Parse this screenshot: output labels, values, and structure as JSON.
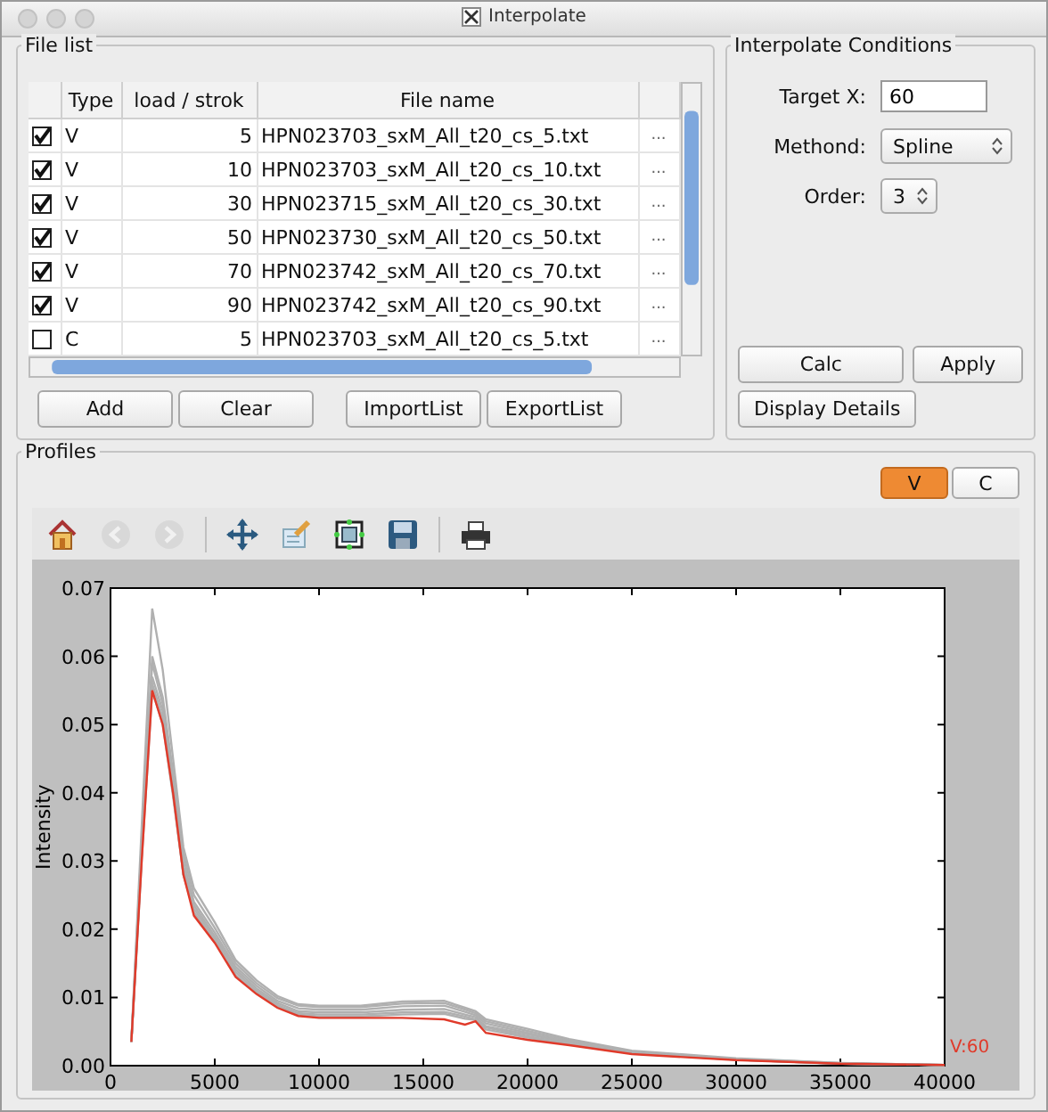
{
  "window": {
    "title": "Interpolate"
  },
  "file_list": {
    "title": "File list",
    "columns": [
      "Type",
      "load / strok",
      "File name"
    ],
    "rows": [
      {
        "checked": true,
        "type": "V",
        "load": "5",
        "file": "HPN023703_sxM_All_t20_cs_5.txt",
        "more": "..."
      },
      {
        "checked": true,
        "type": "V",
        "load": "10",
        "file": "HPN023703_sxM_All_t20_cs_10.txt",
        "more": "..."
      },
      {
        "checked": true,
        "type": "V",
        "load": "30",
        "file": "HPN023715_sxM_All_t20_cs_30.txt",
        "more": "..."
      },
      {
        "checked": true,
        "type": "V",
        "load": "50",
        "file": "HPN023730_sxM_All_t20_cs_50.txt",
        "more": "..."
      },
      {
        "checked": true,
        "type": "V",
        "load": "70",
        "file": "HPN023742_sxM_All_t20_cs_70.txt",
        "more": "..."
      },
      {
        "checked": true,
        "type": "V",
        "load": "90",
        "file": "HPN023742_sxM_All_t20_cs_90.txt",
        "more": "..."
      },
      {
        "checked": false,
        "type": "C",
        "load": "5",
        "file": "HPN023703_sxM_All_t20_cs_5.txt",
        "more": "..."
      }
    ],
    "buttons": [
      "Add",
      "Clear",
      "ImportList",
      "ExportList"
    ]
  },
  "conditions": {
    "title": "Interpolate Conditions",
    "target_label": "Target X:",
    "target_value": "60",
    "method_label": "Methond:",
    "method_value": "Spline",
    "order_label": "Order:",
    "order_value": "3",
    "buttons": [
      "Calc",
      "Apply",
      "Display Details"
    ]
  },
  "profiles": {
    "title": "Profiles",
    "toggles": [
      {
        "label": "V",
        "selected": true
      },
      {
        "label": "C",
        "selected": false
      }
    ],
    "toolbar": [
      {
        "kind": "home",
        "disabled": false
      },
      {
        "kind": "back",
        "disabled": true
      },
      {
        "kind": "forward",
        "disabled": true
      },
      {
        "kind": "sep"
      },
      {
        "kind": "pan",
        "disabled": false
      },
      {
        "kind": "edit",
        "disabled": false
      },
      {
        "kind": "subplots",
        "disabled": false
      },
      {
        "kind": "save",
        "disabled": false
      },
      {
        "kind": "sep"
      },
      {
        "kind": "print",
        "disabled": false
      }
    ],
    "chart_data": {
      "type": "line",
      "ylabel": "Intensity",
      "x": [
        1000,
        1500,
        2000,
        2500,
        3000,
        3500,
        4000,
        5000,
        6000,
        7000,
        8000,
        9000,
        10000,
        12000,
        14000,
        16000,
        17000,
        17500,
        18000,
        20000,
        22000,
        25000,
        30000,
        35000,
        40000
      ],
      "series": [
        {
          "color": "#b0b0b0",
          "values": [
            0.0035,
            0.035,
            0.067,
            0.058,
            0.045,
            0.032,
            0.026,
            0.021,
            0.0155,
            0.0125,
            0.0102,
            0.009,
            0.0088,
            0.0088,
            0.0094,
            0.0095,
            0.0085,
            0.008,
            0.0068,
            0.0054,
            0.0039,
            0.0022,
            0.0011,
            0.0004,
            0.0001
          ]
        },
        {
          "color": "#b0b0b0",
          "values": [
            0.0035,
            0.033,
            0.06,
            0.054,
            0.043,
            0.031,
            0.025,
            0.0202,
            0.015,
            0.0121,
            0.0099,
            0.0088,
            0.0086,
            0.0086,
            0.0091,
            0.0092,
            0.0082,
            0.0077,
            0.0065,
            0.0051,
            0.0037,
            0.002,
            0.001,
            0.0004,
            0.0001
          ]
        },
        {
          "color": "#b0b0b0",
          "values": [
            0.0035,
            0.032,
            0.059,
            0.053,
            0.042,
            0.03,
            0.024,
            0.0195,
            0.0145,
            0.0117,
            0.0095,
            0.0084,
            0.0082,
            0.0082,
            0.0087,
            0.0088,
            0.0079,
            0.0074,
            0.0062,
            0.0048,
            0.0035,
            0.0019,
            0.001,
            0.0003,
            0.0001
          ]
        },
        {
          "color": "#b0b0b0",
          "values": [
            0.0035,
            0.031,
            0.057,
            0.052,
            0.041,
            0.029,
            0.0235,
            0.019,
            0.0141,
            0.0113,
            0.0092,
            0.008,
            0.0078,
            0.0078,
            0.0082,
            0.0083,
            0.0075,
            0.0071,
            0.0058,
            0.0046,
            0.0034,
            0.0019,
            0.0009,
            0.0003,
            0.0001
          ]
        },
        {
          "color": "#b0b0b0",
          "values": [
            0.0035,
            0.031,
            0.056,
            0.051,
            0.04,
            0.028,
            0.023,
            0.0186,
            0.0137,
            0.011,
            0.0089,
            0.0077,
            0.0075,
            0.0075,
            0.0078,
            0.0079,
            0.0072,
            0.0068,
            0.0056,
            0.0043,
            0.0032,
            0.0018,
            0.0009,
            0.0003,
            0.0001
          ]
        },
        {
          "color": "#b0b0b0",
          "values": [
            0.0035,
            0.03,
            0.055,
            0.05,
            0.0395,
            0.028,
            0.0225,
            0.0182,
            0.0133,
            0.0107,
            0.0087,
            0.0075,
            0.0072,
            0.0072,
            0.0075,
            0.0076,
            0.0069,
            0.0067,
            0.0053,
            0.0041,
            0.0031,
            0.0018,
            0.0009,
            0.0003,
            0.0001
          ]
        },
        {
          "color": "#e03a2a",
          "values": [
            0.0035,
            0.03,
            0.055,
            0.05,
            0.04,
            0.028,
            0.022,
            0.018,
            0.013,
            0.0105,
            0.0085,
            0.0073,
            0.007,
            0.007,
            0.007,
            0.0068,
            0.006,
            0.0065,
            0.0048,
            0.0038,
            0.003,
            0.0017,
            0.0008,
            0.0003,
            0.0001
          ]
        }
      ],
      "xlim": [
        0,
        40000
      ],
      "ylim": [
        0,
        0.07
      ],
      "xticks": [
        {
          "value": 0,
          "label": "0"
        },
        {
          "value": 5000,
          "label": "5000"
        },
        {
          "value": 10000,
          "label": "10000"
        },
        {
          "value": 15000,
          "label": "15000"
        },
        {
          "value": 20000,
          "label": "20000"
        },
        {
          "value": 25000,
          "label": "25000"
        },
        {
          "value": 30000,
          "label": "30000"
        },
        {
          "value": 35000,
          "label": "35000"
        },
        {
          "value": 40000,
          "label": "40000"
        }
      ],
      "yticks": [
        {
          "value": 0,
          "label": "0.00"
        },
        {
          "value": 0.01,
          "label": "0.01"
        },
        {
          "value": 0.02,
          "label": "0.02"
        },
        {
          "value": 0.03,
          "label": "0.03"
        },
        {
          "value": 0.04,
          "label": "0.04"
        },
        {
          "value": 0.05,
          "label": "0.05"
        },
        {
          "value": 0.06,
          "label": "0.06"
        },
        {
          "value": 0.07,
          "label": "0.07"
        }
      ],
      "annotations": [
        "V:60"
      ]
    }
  }
}
